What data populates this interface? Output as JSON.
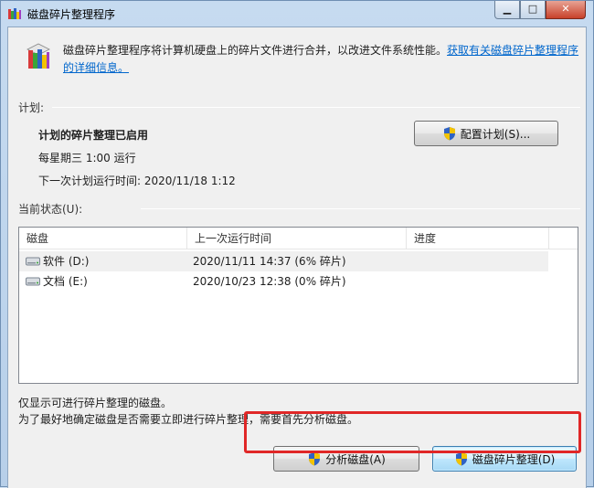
{
  "window": {
    "title": "磁盘碎片整理程序"
  },
  "header": {
    "description": "磁盘碎片整理程序将计算机硬盘上的碎片文件进行合并，以改进文件系统性能。",
    "help_link": "获取有关磁盘碎片整理程序的详细信息。"
  },
  "schedule": {
    "section_label": "计划:",
    "status": "计划的碎片整理已启用",
    "frequency": "每星期三  1:00 运行",
    "next_run": "下一次计划运行时间: 2020/11/18 1:12",
    "configure_button": "配置计划(S)..."
  },
  "current_status": {
    "section_label": "当前状态(U):",
    "columns": [
      "磁盘",
      "上一次运行时间",
      "进度"
    ],
    "rows": [
      {
        "disk": "软件 (D:)",
        "last_run": "2020/11/11 14:37 (6% 碎片)",
        "progress": ""
      },
      {
        "disk": "文档 (E:)",
        "last_run": "2020/10/23 12:38 (0% 碎片)",
        "progress": ""
      }
    ]
  },
  "notes": {
    "line1": "仅显示可进行碎片整理的磁盘。",
    "line2": "为了最好地确定磁盘是否需要立即进行碎片整理，需要首先分析磁盘。"
  },
  "actions": {
    "analyze_button": "分析磁盘(A)",
    "defrag_button": "磁盘碎片整理(D)"
  },
  "colors": {
    "link": "#0066cc",
    "highlight": "#e02727",
    "shield_blue": "#2f63c4",
    "shield_yellow": "#f3c300"
  }
}
